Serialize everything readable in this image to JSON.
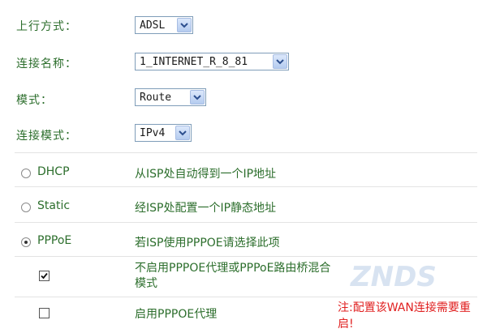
{
  "form": {
    "uplink_label": "上行方式：",
    "uplink_value": "ADSL",
    "conn_name_label": "连接名称：",
    "conn_name_value": "1_INTERNET_R_8_81",
    "mode_label": "模式：",
    "mode_value": "Route",
    "conn_mode_label": "连接模式：",
    "conn_mode_value": "IPv4"
  },
  "options": [
    {
      "label": "DHCP",
      "desc": "从ISP处自动得到一个IP地址",
      "selected": false
    },
    {
      "label": "Static",
      "desc": "经ISP处配置一个IP静态地址",
      "selected": false
    },
    {
      "label": "PPPoE",
      "desc": "若ISP使用PPPOE请选择此项",
      "selected": true
    }
  ],
  "checkboxes": [
    {
      "desc": "不启用PPPOE代理或PPPoE路由桥混合模式",
      "checked": true
    },
    {
      "desc": "启用PPPOE代理",
      "checked": false
    }
  ],
  "note": "注:配置该WAN连接需要重启!",
  "icons": {
    "dropdown": "chevron-down-icon",
    "radio": "radio-icon",
    "checkbox": "checkbox-icon"
  },
  "colors": {
    "label": "#2c6e2c",
    "note": "#e02020"
  },
  "watermark": "ZNDS"
}
